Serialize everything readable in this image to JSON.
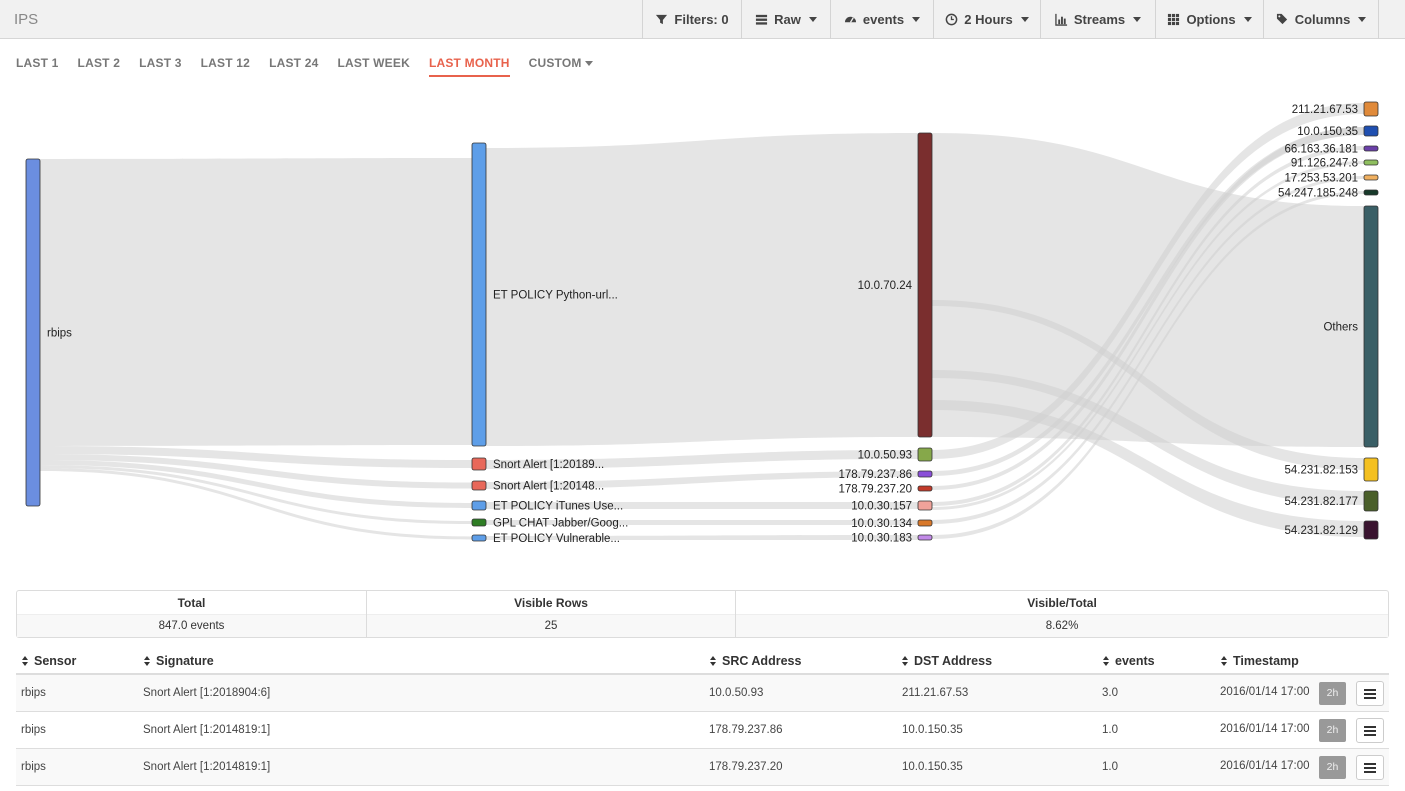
{
  "app_title": "IPS",
  "toolbar": [
    {
      "label": "Filters: 0",
      "icon": "filter-icon",
      "caret": false
    },
    {
      "label": "Raw",
      "icon": "list-icon",
      "caret": true
    },
    {
      "label": "events",
      "icon": "dashboard-icon",
      "caret": true
    },
    {
      "label": "2 Hours",
      "icon": "clock-icon",
      "caret": true
    },
    {
      "label": "Streams",
      "icon": "bar-chart-icon",
      "caret": true
    },
    {
      "label": "Options",
      "icon": "grid-icon",
      "caret": true
    },
    {
      "label": "Columns",
      "icon": "tags-icon",
      "caret": true
    }
  ],
  "tabs": [
    {
      "label": "LAST 1",
      "active": false
    },
    {
      "label": "LAST 2",
      "active": false
    },
    {
      "label": "LAST 3",
      "active": false
    },
    {
      "label": "LAST 12",
      "active": false
    },
    {
      "label": "LAST 24",
      "active": false
    },
    {
      "label": "LAST WEEK",
      "active": false
    },
    {
      "label": "LAST MONTH",
      "active": true
    },
    {
      "label": "CUSTOM",
      "active": false,
      "caret": true
    }
  ],
  "sankey": {
    "sensors": [
      {
        "label": "rbips",
        "color": "#6b8ee0"
      }
    ],
    "signatures": [
      {
        "label": "ET POLICY Python-url...",
        "color": "#5e9ee8"
      },
      {
        "label": "Snort Alert [1:20189...",
        "color": "#e8685a"
      },
      {
        "label": "Snort Alert [1:20148...",
        "color": "#e8685a"
      },
      {
        "label": "ET POLICY iTunes Use...",
        "color": "#5e9ee8"
      },
      {
        "label": "GPL CHAT Jabber/Goog...",
        "color": "#2e7d24"
      },
      {
        "label": "ET POLICY Vulnerable...",
        "color": "#5e9ee8"
      }
    ],
    "src_addresses": [
      {
        "label": "10.0.70.24",
        "color": "#7a2e2e"
      },
      {
        "label": "10.0.50.93",
        "color": "#86a84a"
      },
      {
        "label": "178.79.237.86",
        "color": "#8a4fd8"
      },
      {
        "label": "178.79.237.20",
        "color": "#c23a2a"
      },
      {
        "label": "10.0.30.157",
        "color": "#f0a29a"
      },
      {
        "label": "10.0.30.134",
        "color": "#d8782a"
      },
      {
        "label": "10.0.30.183",
        "color": "#c28ae8"
      }
    ],
    "dst_addresses": [
      {
        "label": "211.21.67.53",
        "color": "#e08a3a"
      },
      {
        "label": "10.0.150.35",
        "color": "#1f4fb0"
      },
      {
        "label": "66.163.36.181",
        "color": "#6a3fa8"
      },
      {
        "label": "91.126.247.8",
        "color": "#8fbf5f"
      },
      {
        "label": "17.253.53.201",
        "color": "#f0b060"
      },
      {
        "label": "54.247.185.248",
        "color": "#173a2a"
      },
      {
        "label": "Others",
        "color": "#3a5f66"
      },
      {
        "label": "54.231.82.153",
        "color": "#f4c020"
      },
      {
        "label": "54.231.82.177",
        "color": "#4a5f2a"
      },
      {
        "label": "54.231.82.129",
        "color": "#3a1430"
      }
    ]
  },
  "summary": {
    "total_label": "Total",
    "total_value": "847.0 events",
    "visible_label": "Visible Rows",
    "visible_value": "25",
    "ratio_label": "Visible/Total",
    "ratio_value": "8.62%"
  },
  "table": {
    "headers": [
      "Sensor",
      "Signature",
      "SRC Address",
      "DST Address",
      "events",
      "Timestamp"
    ],
    "rows": [
      {
        "sensor": "rbips",
        "signature": "Snort Alert [1:2018904:6]",
        "src": "10.0.50.93",
        "dst": "211.21.67.53",
        "events": "3.0",
        "timestamp": "2016/01/14 17:00",
        "badge": "2h"
      },
      {
        "sensor": "rbips",
        "signature": "Snort Alert [1:2014819:1]",
        "src": "178.79.237.86",
        "dst": "10.0.150.35",
        "events": "1.0",
        "timestamp": "2016/01/14 17:00",
        "badge": "2h"
      },
      {
        "sensor": "rbips",
        "signature": "Snort Alert [1:2014819:1]",
        "src": "178.79.237.20",
        "dst": "10.0.150.35",
        "events": "1.0",
        "timestamp": "2016/01/14 17:00",
        "badge": "2h"
      }
    ]
  }
}
